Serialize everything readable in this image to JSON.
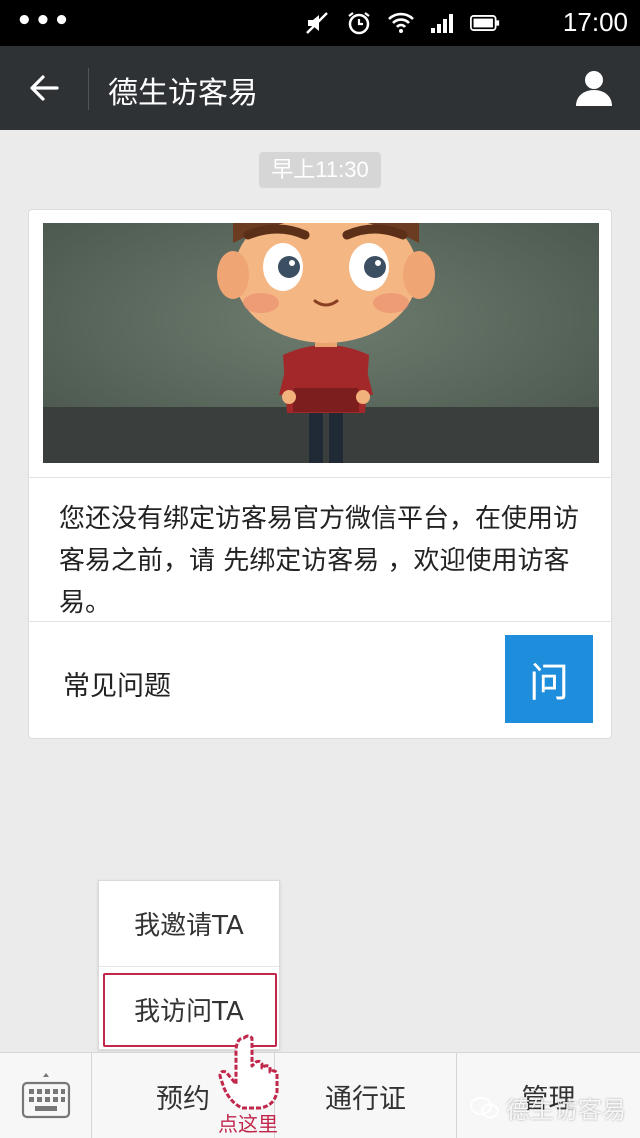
{
  "status_bar": {
    "dots": "•••",
    "time": "17:00"
  },
  "header": {
    "title": "德生访客易"
  },
  "chat": {
    "timestamp": "早上11:30",
    "card": {
      "message": "您还没有绑定访客易官方微信平台，在使用访客易之前，请 先绑定访客易 ，欢迎使用访客易。",
      "faq_label": "常见问题",
      "faq_button": "问"
    }
  },
  "popup_menu": {
    "items": [
      {
        "label": "我邀请TA"
      },
      {
        "label": "我访问TA"
      }
    ]
  },
  "bottom_menu": {
    "tabs": [
      {
        "label": "预约"
      },
      {
        "label": "通行证"
      },
      {
        "label": "管理"
      }
    ]
  },
  "annotation": {
    "click_here": "点这里"
  },
  "watermark": {
    "text": "德生访客易"
  },
  "colors": {
    "accent_blue": "#1d8ddc",
    "highlight_red": "#c1264b",
    "header_bg": "#2f3235"
  },
  "icons": [
    "back-arrow-icon",
    "user-icon",
    "keyboard-icon",
    "hand-pointer-icon",
    "wechat-icon",
    "wifi-icon",
    "signal-icon",
    "battery-icon",
    "alarm-icon",
    "mute-icon"
  ]
}
